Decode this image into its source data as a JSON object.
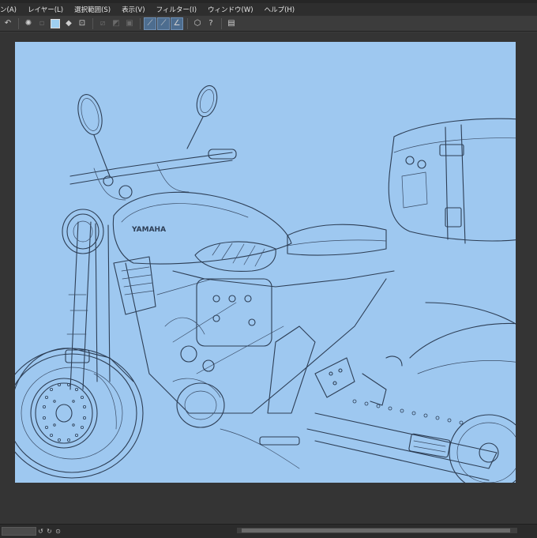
{
  "menubar": {
    "items": [
      {
        "label": "ン(A)"
      },
      {
        "label": "レイヤー(L)"
      },
      {
        "label": "選択範囲(S)"
      },
      {
        "label": "表示(V)"
      },
      {
        "label": "フィルター(I)"
      },
      {
        "label": "ウィンドウ(W)"
      },
      {
        "label": "ヘルプ(H)"
      }
    ]
  },
  "toolbar": {
    "icons": [
      "undo-icon",
      "loading-spinner-icon",
      "select-all-icon",
      "layer-color-swatch",
      "fill-bucket-icon",
      "transform-icon",
      "clear-selection-icon",
      "tone-icon",
      "mask-icon",
      "ruler-curve-icon",
      "ruler-line-icon",
      "ruler-angle-icon",
      "3d-icon",
      "help-icon",
      "document-icon"
    ],
    "swatch_color": "#9fcff0",
    "active_color": "#4d6d8f"
  },
  "canvas": {
    "background": "#9ec8f0",
    "line_color": "#2d3e55",
    "subject": "motorcycle line art"
  },
  "colors": {
    "window_bg": "#343434",
    "menubar_bg": "#2e2e2e"
  }
}
